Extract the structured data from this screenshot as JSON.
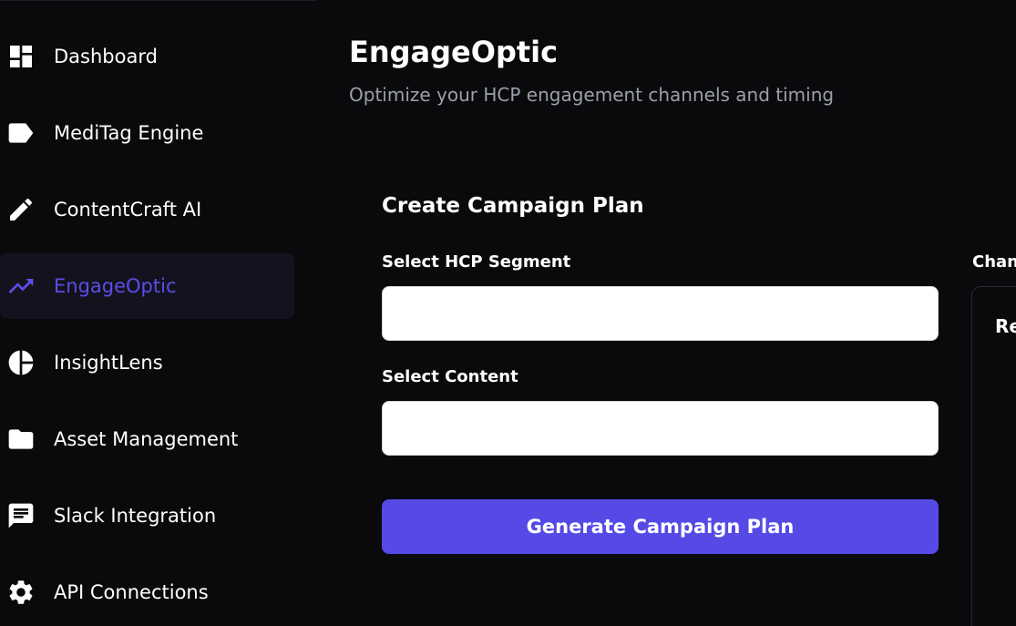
{
  "sidebar": {
    "items": [
      {
        "label": "Dashboard",
        "icon": "dashboard-icon",
        "active": false
      },
      {
        "label": "MediTag Engine",
        "icon": "tag-icon",
        "active": false
      },
      {
        "label": "ContentCraft AI",
        "icon": "pencil-icon",
        "active": false
      },
      {
        "label": "EngageOptic",
        "icon": "trending-up-icon",
        "active": true
      },
      {
        "label": "InsightLens",
        "icon": "pie-chart-icon",
        "active": false
      },
      {
        "label": "Asset Management",
        "icon": "folder-icon",
        "active": false
      },
      {
        "label": "Slack Integration",
        "icon": "chat-icon",
        "active": false
      },
      {
        "label": "API Connections",
        "icon": "gear-icon",
        "active": false
      }
    ]
  },
  "main": {
    "title": "EngageOptic",
    "subtitle": "Optimize your HCP engagement channels and timing",
    "form": {
      "section_title": "Create Campaign Plan",
      "segment_label": "Select HCP Segment",
      "segment_value": "",
      "content_label": "Select Content",
      "content_value": "",
      "generate_label": "Generate Campaign Plan"
    },
    "right_panel": {
      "label": "Chan",
      "heading": "Re"
    }
  },
  "colors": {
    "background": "#0a090c",
    "accent": "#554ae6",
    "active_nav_bg": "#14121e",
    "subtitle": "#9aa0ab"
  }
}
